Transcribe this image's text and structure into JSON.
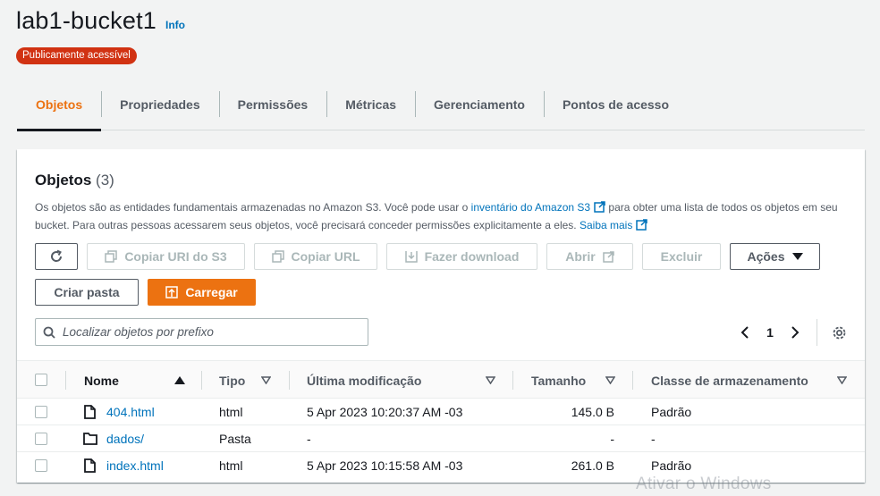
{
  "header": {
    "title": "lab1-bucket1",
    "info_label": "Info",
    "badge": "Publicamente acessível"
  },
  "tabs": [
    {
      "label": "Objetos",
      "active": true
    },
    {
      "label": "Propriedades"
    },
    {
      "label": "Permissões"
    },
    {
      "label": "Métricas"
    },
    {
      "label": "Gerenciamento"
    },
    {
      "label": "Pontos de acesso"
    }
  ],
  "objects": {
    "title": "Objetos",
    "count": "(3)",
    "desc_part1": "Os objetos são as entidades fundamentais armazenadas no Amazon S3. Você pode usar o ",
    "desc_link1": "inventário do Amazon S3",
    "desc_part2": " para obter uma lista de todos os objetos em seu bucket. Para outras pessoas acessarem seus objetos, você precisará conceder permissões explicitamente a eles. ",
    "desc_link2": "Saiba mais",
    "buttons": {
      "copy_s3_uri": "Copiar URI do S3",
      "copy_url": "Copiar URL",
      "download": "Fazer download",
      "open": "Abrir",
      "delete": "Excluir",
      "actions": "Ações",
      "create_folder": "Criar pasta",
      "upload": "Carregar"
    },
    "search_placeholder": "Localizar objetos por prefixo",
    "page": "1"
  },
  "table": {
    "columns": {
      "name": "Nome",
      "type": "Tipo",
      "modified": "Última modificação",
      "size": "Tamanho",
      "storage": "Classe de armazenamento"
    },
    "rows": [
      {
        "name": "404.html",
        "type": "html",
        "modified": "5 Apr 2023 10:20:37 AM -03",
        "size": "145.0 B",
        "storage": "Padrão",
        "icon": "file-icon"
      },
      {
        "name": "dados/",
        "type": "Pasta",
        "modified": "-",
        "size": "-",
        "storage": "-",
        "icon": "folder-icon"
      },
      {
        "name": "index.html",
        "type": "html",
        "modified": "5 Apr 2023 10:15:58 AM -03",
        "size": "261.0 B",
        "storage": "Padrão",
        "icon": "file-icon"
      }
    ]
  },
  "watermark": "Ativar o Windows",
  "colors": {
    "accent": "#ec7211",
    "link": "#0073bb",
    "badge": "#d13212"
  }
}
